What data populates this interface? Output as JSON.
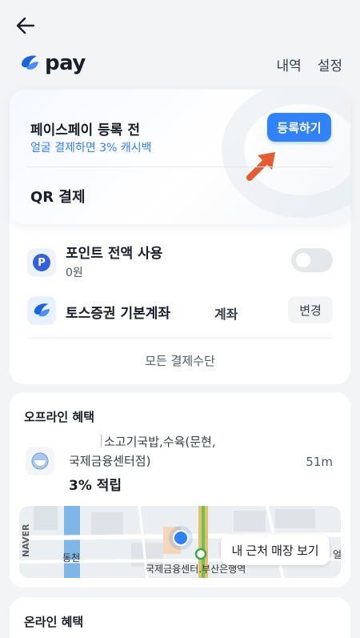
{
  "header": {
    "logo_text": "pay",
    "links": [
      "내역",
      "설정"
    ]
  },
  "face_pay": {
    "title": "페이스페이 등록 전",
    "subtitle": "얼굴 결제하면 3% 캐시백",
    "register_button": "등록하기",
    "qr_title": "QR 결제"
  },
  "payment": {
    "point_label": "포인트 전액 사용",
    "point_value": "0원",
    "point_icon_letter": "P",
    "toggle_on": false,
    "account_label": "토스증권 기본계좌",
    "account_type": "계좌",
    "change_button": "변경",
    "all_methods": "모든 결제수단"
  },
  "offline": {
    "title": "오프라인 혜택",
    "store_name_line1": "소고기국밥,수육(문현,",
    "store_name_line2": "국제금융센터점)",
    "distance": "51m",
    "benefit": "3% 적립",
    "near_button": "내 근처 매장 보기",
    "map_labels": {
      "brand": "NAVER",
      "place_left": "동천",
      "station": "국제금융센터.부산은행역",
      "right": "얼"
    }
  },
  "online": {
    "title": "온라인 혜택"
  },
  "colors": {
    "accent": "#3182f6",
    "background": "#f2f4f6",
    "arrow": "#e45c32"
  }
}
